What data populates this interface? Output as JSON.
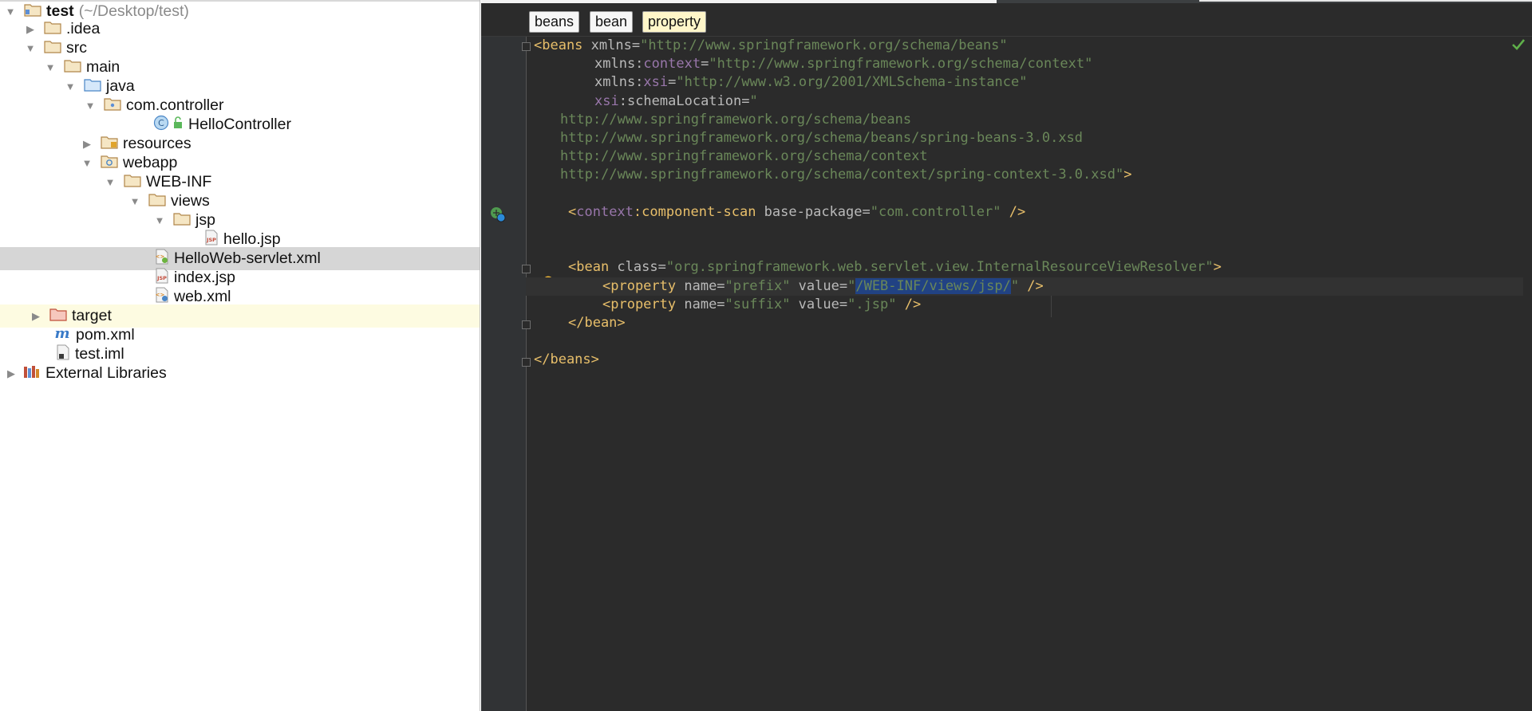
{
  "tree": {
    "items": [
      {
        "label": "test",
        "hint": "(~/Desktop/test)",
        "arrow": "expanded",
        "icon": "project-folder-icon"
      },
      {
        "label": ".idea",
        "arrow": "collapsed",
        "icon": "folder-icon"
      },
      {
        "label": "src",
        "arrow": "expanded",
        "icon": "folder-icon"
      },
      {
        "label": "main",
        "arrow": "expanded",
        "icon": "folder-icon"
      },
      {
        "label": "java",
        "arrow": "expanded",
        "icon": "source-folder-icon"
      },
      {
        "label": "com.controller",
        "arrow": "expanded",
        "icon": "package-icon"
      },
      {
        "label": "HelloController",
        "arrow": "none",
        "icon": "java-class-icon"
      },
      {
        "label": "resources",
        "arrow": "collapsed",
        "icon": "resources-folder-icon"
      },
      {
        "label": "webapp",
        "arrow": "expanded",
        "icon": "web-folder-icon"
      },
      {
        "label": "WEB-INF",
        "arrow": "expanded",
        "icon": "folder-icon"
      },
      {
        "label": "views",
        "arrow": "expanded",
        "icon": "folder-icon"
      },
      {
        "label": "jsp",
        "arrow": "expanded",
        "icon": "folder-icon"
      },
      {
        "label": "hello.jsp",
        "arrow": "none",
        "icon": "jsp-file-icon"
      },
      {
        "label": "HelloWeb-servlet.xml",
        "arrow": "none",
        "icon": "spring-xml-icon",
        "selected": true
      },
      {
        "label": "index.jsp",
        "arrow": "none",
        "icon": "jsp-file-icon"
      },
      {
        "label": "web.xml",
        "arrow": "none",
        "icon": "web-xml-icon"
      },
      {
        "label": "target",
        "arrow": "collapsed",
        "icon": "excluded-folder-icon",
        "highlighted": true
      },
      {
        "label": "pom.xml",
        "arrow": "none",
        "icon": "maven-icon"
      },
      {
        "label": "test.iml",
        "arrow": "none",
        "icon": "iml-file-icon"
      },
      {
        "label": "External Libraries",
        "arrow": "collapsed",
        "icon": "libraries-icon"
      }
    ]
  },
  "editor": {
    "breadcrumbs": [
      "beans",
      "bean",
      "property"
    ],
    "code": {
      "l1_tag": "<beans",
      "l1_attr": " xmlns=",
      "l1_val": "\"http://www.springframework.org/schema/beans\"",
      "l2_attr": "xmlns:",
      "l2_ns": "context",
      "l2_eq": "=",
      "l2_val": "\"http://www.springframework.org/schema/context\"",
      "l3_attr": "xmlns:",
      "l3_ns": "xsi",
      "l3_eq": "=",
      "l3_val": "\"http://www.w3.org/2001/XMLSchema-instance\"",
      "l4_ns": "xsi",
      "l4_attr": ":schemaLocation=",
      "l4_val": "\"",
      "l5": "http://www.springframework.org/schema/beans",
      "l6": "http://www.springframework.org/schema/beans/spring-beans-3.0.xsd",
      "l7": "http://www.springframework.org/schema/context",
      "l8_val": "http://www.springframework.org/schema/context/spring-context-3.0.xsd\"",
      "l8_tag": ">",
      "l10_tag_open": "<",
      "l10_ns": "context",
      "l10_tag_name": ":component-scan",
      "l10_attr": " base-package=",
      "l10_val": "\"com.controller\"",
      "l10_close": " />",
      "l13_tag": "<bean",
      "l13_attr": " class=",
      "l13_val": "\"org.springframework.web.servlet.view.InternalResourceViewResolver\"",
      "l13_close": ">",
      "l14_tag": "<property",
      "l14_attr1": " name=",
      "l14_val1": "\"prefix\"",
      "l14_attr2": " value=",
      "l14_val2a": "\"",
      "l14_val2sel": "/WEB-INF/views/jsp/",
      "l14_val2b": "\"",
      "l14_close": " />",
      "l15_tag": "<property",
      "l15_attr1": " name=",
      "l15_val1": "\"suffix\"",
      "l15_attr2": " value=",
      "l15_val2": "\".jsp\"",
      "l15_close": " />",
      "l16_tag": "</bean>",
      "l18_tag": "</beans>"
    },
    "colors": {
      "background": "#2b2b2b",
      "tag": "#e8bf6a",
      "attribute": "#bababa",
      "namespace": "#9876aa",
      "value": "#6a8759",
      "selection": "#214283"
    }
  }
}
